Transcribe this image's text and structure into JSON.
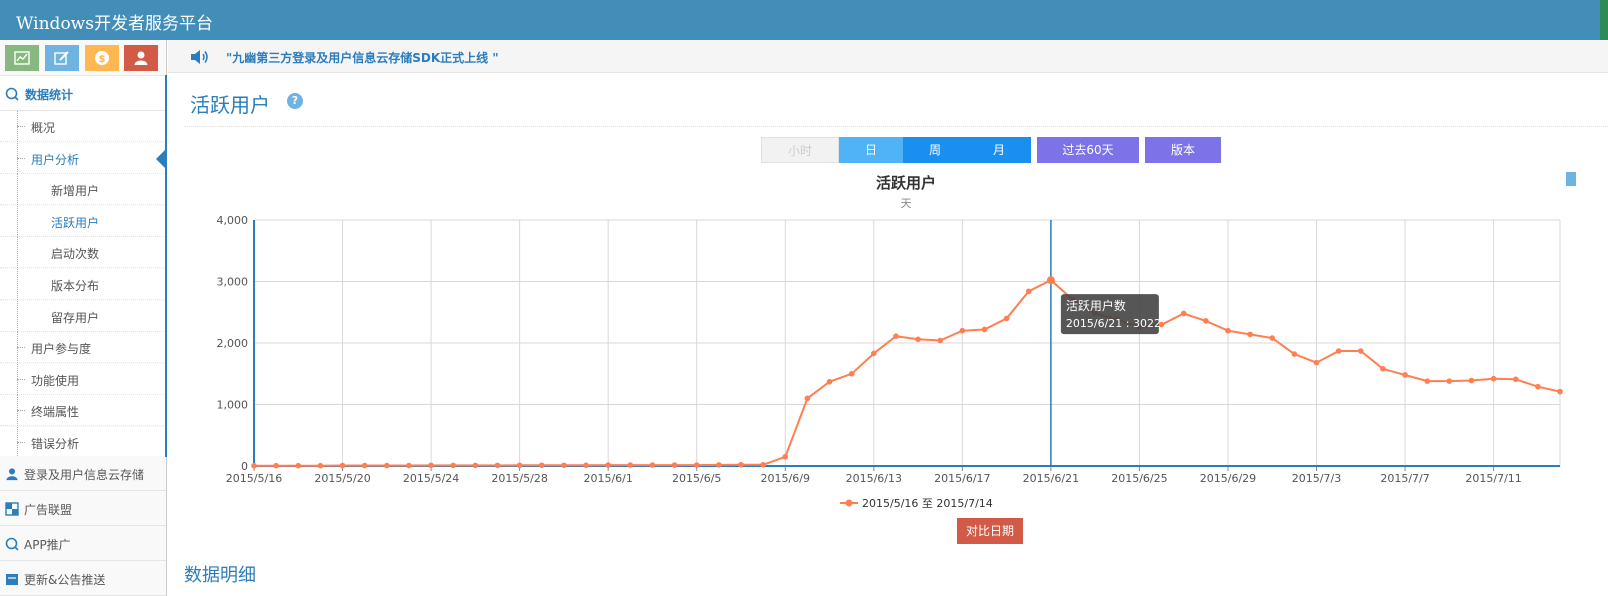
{
  "app_title": "Windows开发者服务平台",
  "notice": "\"九幽第三方登录及用户信息云存储SDK正式上线 \"",
  "page_title": "活跃用户",
  "help_glyph": "?",
  "colors": {
    "topbar": "#438eb9",
    "accent": "#2b7dbc",
    "line": "#ff7f50",
    "purple": "#7d73e8",
    "red": "#d15b47"
  },
  "shortcuts": [
    {
      "icon": "chart-icon",
      "color": "#87b87f"
    },
    {
      "icon": "edit-icon",
      "color": "#6fb3e0"
    },
    {
      "icon": "coin-icon",
      "color": "#ffb752"
    },
    {
      "icon": "user-icon",
      "color": "#d15b47"
    }
  ],
  "sidebar": {
    "main": "数据统计",
    "items": [
      {
        "label": "概况",
        "level": 1
      },
      {
        "label": "用户分析",
        "level": 1,
        "active": true
      },
      {
        "label": "新增用户",
        "level": 2
      },
      {
        "label": "活跃用户",
        "level": 2,
        "active": true
      },
      {
        "label": "启动次数",
        "level": 2
      },
      {
        "label": "版本分布",
        "level": 2
      },
      {
        "label": "留存用户",
        "level": 2
      },
      {
        "label": "用户参与度",
        "level": 1
      },
      {
        "label": "功能使用",
        "level": 1
      },
      {
        "label": "终端属性",
        "level": 1
      },
      {
        "label": "错误分析",
        "level": 1
      }
    ],
    "sections": [
      {
        "label": "登录及用户信息云存储",
        "icon": "user-icon"
      },
      {
        "label": "广告联盟",
        "icon": "grid-icon"
      },
      {
        "label": "APP推广",
        "icon": "search-icon"
      },
      {
        "label": "更新&公告推送",
        "icon": "edit-icon"
      }
    ]
  },
  "time_buttons": [
    "小时",
    "日",
    "周",
    "月"
  ],
  "range_button": "过去60天",
  "version_button": "版本",
  "compare_button": "对比日期",
  "detail_title": "数据明细",
  "chart_data": {
    "type": "line",
    "title": "活跃用户",
    "subtitle": "天",
    "ylim": [
      0,
      4000
    ],
    "yticks": [
      "0",
      "1,000",
      "2,000",
      "3,000",
      "4,000"
    ],
    "xticks": [
      "2015/5/16",
      "2015/5/20",
      "2015/5/24",
      "2015/5/28",
      "2015/6/1",
      "2015/6/5",
      "2015/6/9",
      "2015/6/13",
      "2015/6/17",
      "2015/6/21",
      "2015/6/25",
      "2015/6/29",
      "2015/7/3",
      "2015/7/7",
      "2015/7/11"
    ],
    "legend": "2015/5/16 至 2015/7/14",
    "tooltip": {
      "title": "活跃用户数",
      "text": "2015/6/21 : 3022",
      "day": 36
    },
    "series": [
      {
        "values": [
          5,
          5,
          5,
          5,
          8,
          8,
          8,
          8,
          10,
          10,
          10,
          10,
          12,
          12,
          12,
          12,
          15,
          15,
          15,
          15,
          15,
          18,
          20,
          20,
          150,
          1100,
          1370,
          1500,
          1830,
          2110,
          2060,
          2040,
          2200,
          2220,
          2400,
          2840,
          3022,
          2700,
          2480,
          2380,
          2260,
          2300,
          2480,
          2360,
          2200,
          2140,
          2080,
          1820,
          1680,
          1870,
          1870,
          1580,
          1480,
          1380,
          1380,
          1390,
          1420,
          1410,
          1290,
          1210
        ]
      }
    ]
  }
}
